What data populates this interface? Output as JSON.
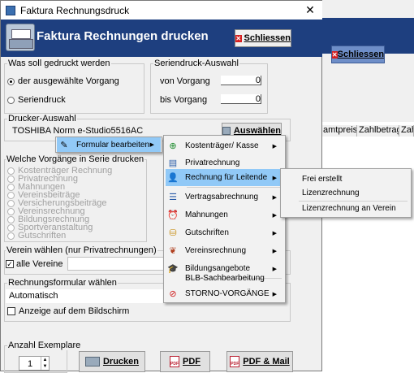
{
  "window": {
    "title": "Faktura Rechnungsdruck",
    "close_glyph": "✕"
  },
  "banner": {
    "title": "Faktura Rechnungen drucken",
    "close_button": "Schliessen"
  },
  "background": {
    "close_button": "Schliessen",
    "columns": [
      "amtpreis",
      "Zahlbetrag",
      "Zah"
    ]
  },
  "group_print": {
    "label": "Was soll gedruckt werden",
    "option_selected": "der ausgewählte Vorgang",
    "option_serial": "Seriendruck"
  },
  "group_serial": {
    "label": "Seriendruck-Auswahl",
    "from_label": "von Vorgang",
    "from_value": "0",
    "to_label": "bis Vorgang",
    "to_value": "0"
  },
  "group_printer": {
    "label": "Drucker-Auswahl",
    "printer_name": "TOSHIBA Norm e-Studio5516AC",
    "select_button": "Auswählen"
  },
  "group_series": {
    "label": "Welche Vorgänge in Serie drucken",
    "options": [
      "Kostenträger Rechnung",
      "Privatrechnung",
      "Mahnungen",
      "Vereinsbeiträge",
      "Versicherungsbeiträge",
      "Vereinsrechnung",
      "Bildungsrechnung",
      "Sportveranstaltung",
      "Gutschriften"
    ]
  },
  "group_club": {
    "label": "Verein wählen (nur Privatrechnungen)",
    "all_clubs": "alle Vereine"
  },
  "group_form": {
    "label": "Rechnungsformular wählen",
    "value": "Automatisch",
    "show_screen": "Anzeige auf dem Bildschirm"
  },
  "group_copies": {
    "label": "Anzahl Exemplare",
    "value": "1"
  },
  "buttons": {
    "print": "Drucken",
    "pdf": "PDF",
    "pdf_mail": "PDF & Mail"
  },
  "menu_root": {
    "item": "Formular bearbeiten"
  },
  "menu_forms": {
    "items": [
      "Kostenträger/ Kasse",
      "Privatrechnung",
      "Rechnung für Leitende",
      "Vertragsabrechnung",
      "Mahnungen",
      "Gutschriften",
      "Vereinsrechnung",
      "Bildungsangebote",
      "BLB-Sachbearbeitung",
      "STORNO-VORGÄNGE"
    ]
  },
  "menu_sub": {
    "items": [
      "Frei erstellt",
      "Lizenzrechnung",
      "Lizenzrechnung an Verein"
    ]
  },
  "colors": {
    "banner": "#1e3f7f",
    "highlight": "#91c9f7",
    "dialog_bg": "#f0f0f0"
  }
}
